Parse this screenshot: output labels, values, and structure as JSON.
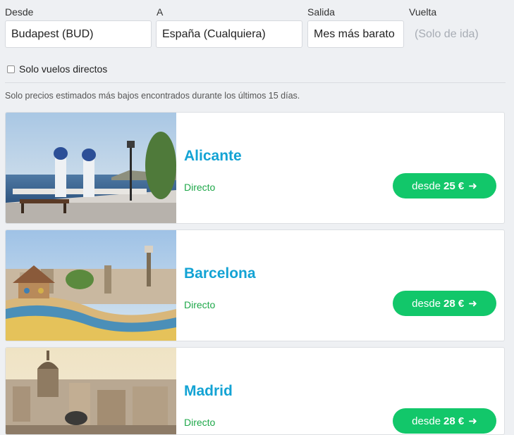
{
  "search": {
    "from_label": "Desde",
    "from_value": "Budapest (BUD)",
    "to_label": "A",
    "to_value": "España (Cualquiera)",
    "depart_label": "Salida",
    "depart_value": "Mes más barato",
    "return_label": "Vuelta",
    "return_value": "(Solo de ida)"
  },
  "filters": {
    "direct_only_label": "Solo vuelos directos",
    "direct_only_checked": false
  },
  "note": "Solo precios estimados más bajos encontrados durante los últimos 15 días.",
  "colors": {
    "city": "#13a3d4",
    "direct": "#1fa84a",
    "price_button": "#12c76a"
  },
  "results": [
    {
      "city": "Alicante",
      "flight_type": "Directo",
      "price_prefix": "desde",
      "price": "25 €",
      "arrow": "➜"
    },
    {
      "city": "Barcelona",
      "flight_type": "Directo",
      "price_prefix": "desde",
      "price": "28 €",
      "arrow": "➜"
    },
    {
      "city": "Madrid",
      "flight_type": "Directo",
      "price_prefix": "desde",
      "price": "28 €",
      "arrow": "➜"
    }
  ]
}
